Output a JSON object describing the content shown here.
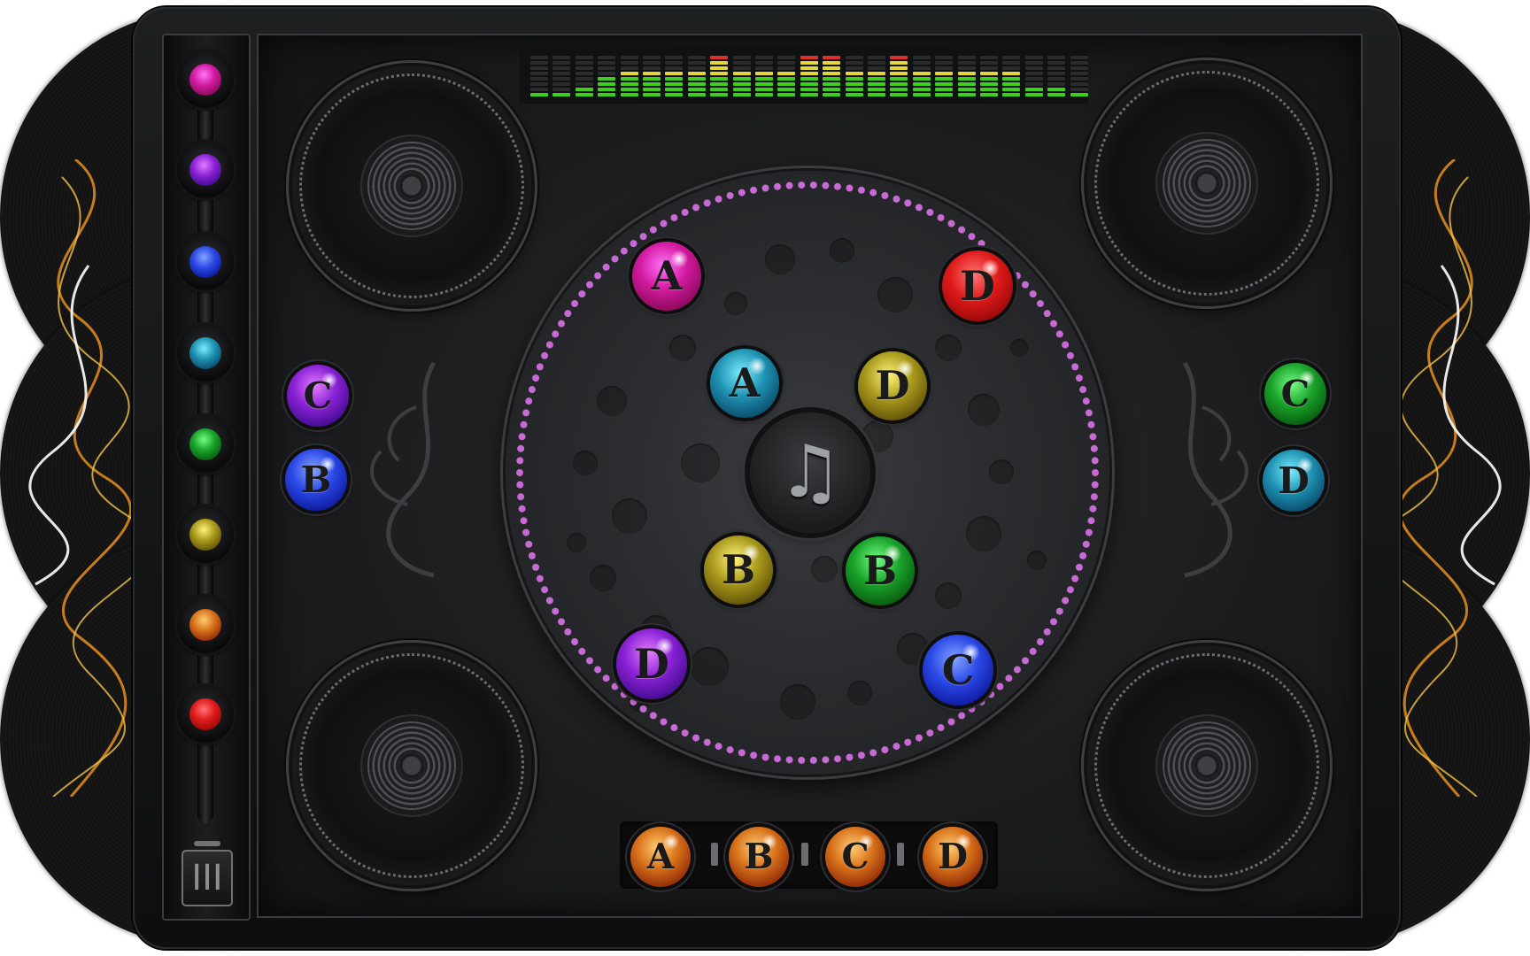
{
  "theme": {
    "background": "#ffffff",
    "cabinet": "#151617",
    "board": "#222427",
    "dot_ring_color": "#c86ad6",
    "eq_green": "#3ccf1e",
    "eq_yellow": "#e2d63a",
    "eq_red": "#e0302a"
  },
  "gem_colors": {
    "magenta": "#d21aa0",
    "purple": "#8a22d6",
    "blue": "#2a49e6",
    "teal": "#1f93b3",
    "green": "#1aa32a",
    "olive": "#a99a1c",
    "orange": "#d8721a",
    "red": "#e01a1a"
  },
  "rack": {
    "gems": [
      "magenta",
      "purple",
      "blue",
      "teal",
      "green",
      "olive",
      "orange",
      "red"
    ],
    "bin_icon": "trash-bin-icon",
    "bin_glyph": "III"
  },
  "center": {
    "icon": "music-note-icon",
    "glyph": "♫"
  },
  "equalizer": {
    "levels": [
      0.15,
      0.15,
      0.3,
      0.45,
      0.6,
      0.6,
      0.6,
      0.6,
      1.0,
      0.6,
      0.6,
      0.6,
      1.0,
      1.0,
      0.6,
      0.6,
      1.0,
      0.6,
      0.6,
      0.6,
      0.6,
      0.6,
      0.3,
      0.3,
      0.15
    ]
  },
  "board_gems": [
    {
      "letter": "A",
      "color": "magenta",
      "ring": "outer"
    },
    {
      "letter": "D",
      "color": "red",
      "ring": "outer"
    },
    {
      "letter": "A",
      "color": "teal",
      "ring": "inner"
    },
    {
      "letter": "D",
      "color": "olive",
      "ring": "inner"
    },
    {
      "letter": "B",
      "color": "olive",
      "ring": "inner"
    },
    {
      "letter": "B",
      "color": "green",
      "ring": "inner"
    },
    {
      "letter": "D",
      "color": "purple",
      "ring": "outer"
    },
    {
      "letter": "C",
      "color": "blue",
      "ring": "outer"
    }
  ],
  "left_side_gems": [
    {
      "letter": "C",
      "color": "purple"
    },
    {
      "letter": "B",
      "color": "blue"
    }
  ],
  "right_side_gems": [
    {
      "letter": "C",
      "color": "green"
    },
    {
      "letter": "D",
      "color": "teal"
    }
  ],
  "answer_tray": [
    {
      "letter": "A",
      "color": "orange"
    },
    {
      "letter": "B",
      "color": "orange"
    },
    {
      "letter": "C",
      "color": "orange"
    },
    {
      "letter": "D",
      "color": "orange"
    }
  ]
}
